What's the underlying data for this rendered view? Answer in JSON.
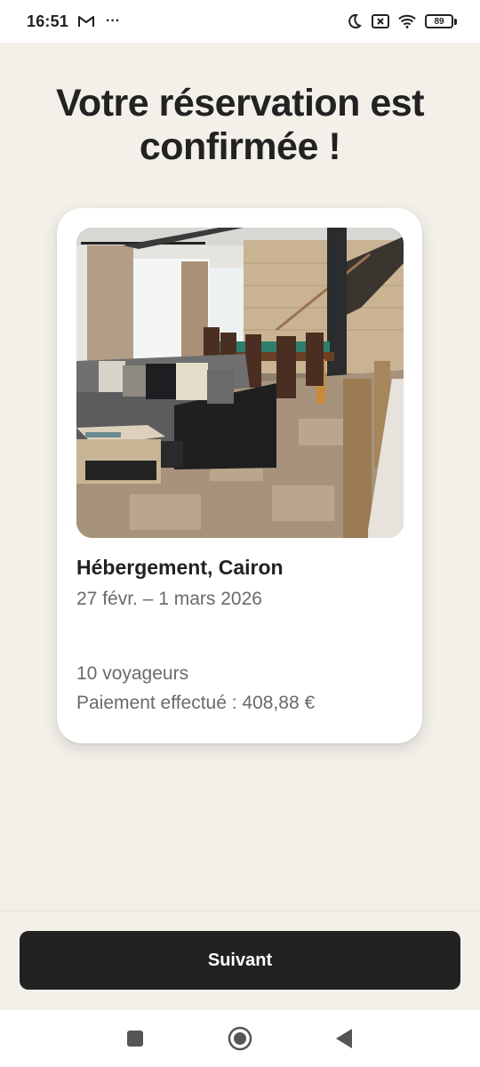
{
  "status_bar": {
    "time": "16:51",
    "left_icons": [
      "gmail-icon",
      "more-icon"
    ],
    "more_glyph": "···",
    "right_icons": [
      "do-not-disturb-moon-icon",
      "no-sim-icon",
      "wifi-icon",
      "battery-icon"
    ],
    "battery_level": "89"
  },
  "page": {
    "title": "Votre réservation est confirmée !"
  },
  "listing": {
    "photo_icon": "living-room-photo",
    "title": "Hébergement, Cairon",
    "dates": "27 févr. – 1 mars 2026",
    "guests": "10 voyageurs",
    "payment": "Paiement effectué : 408,88 €"
  },
  "footer": {
    "next_label": "Suivant"
  },
  "nav_bar": {
    "icons": [
      "recents-square-icon",
      "home-circle-icon",
      "back-triangle-icon"
    ]
  },
  "colors": {
    "background": "#f3f0ea",
    "card": "#ffffff",
    "button": "#222222",
    "secondary_text": "#6a6a6a"
  }
}
